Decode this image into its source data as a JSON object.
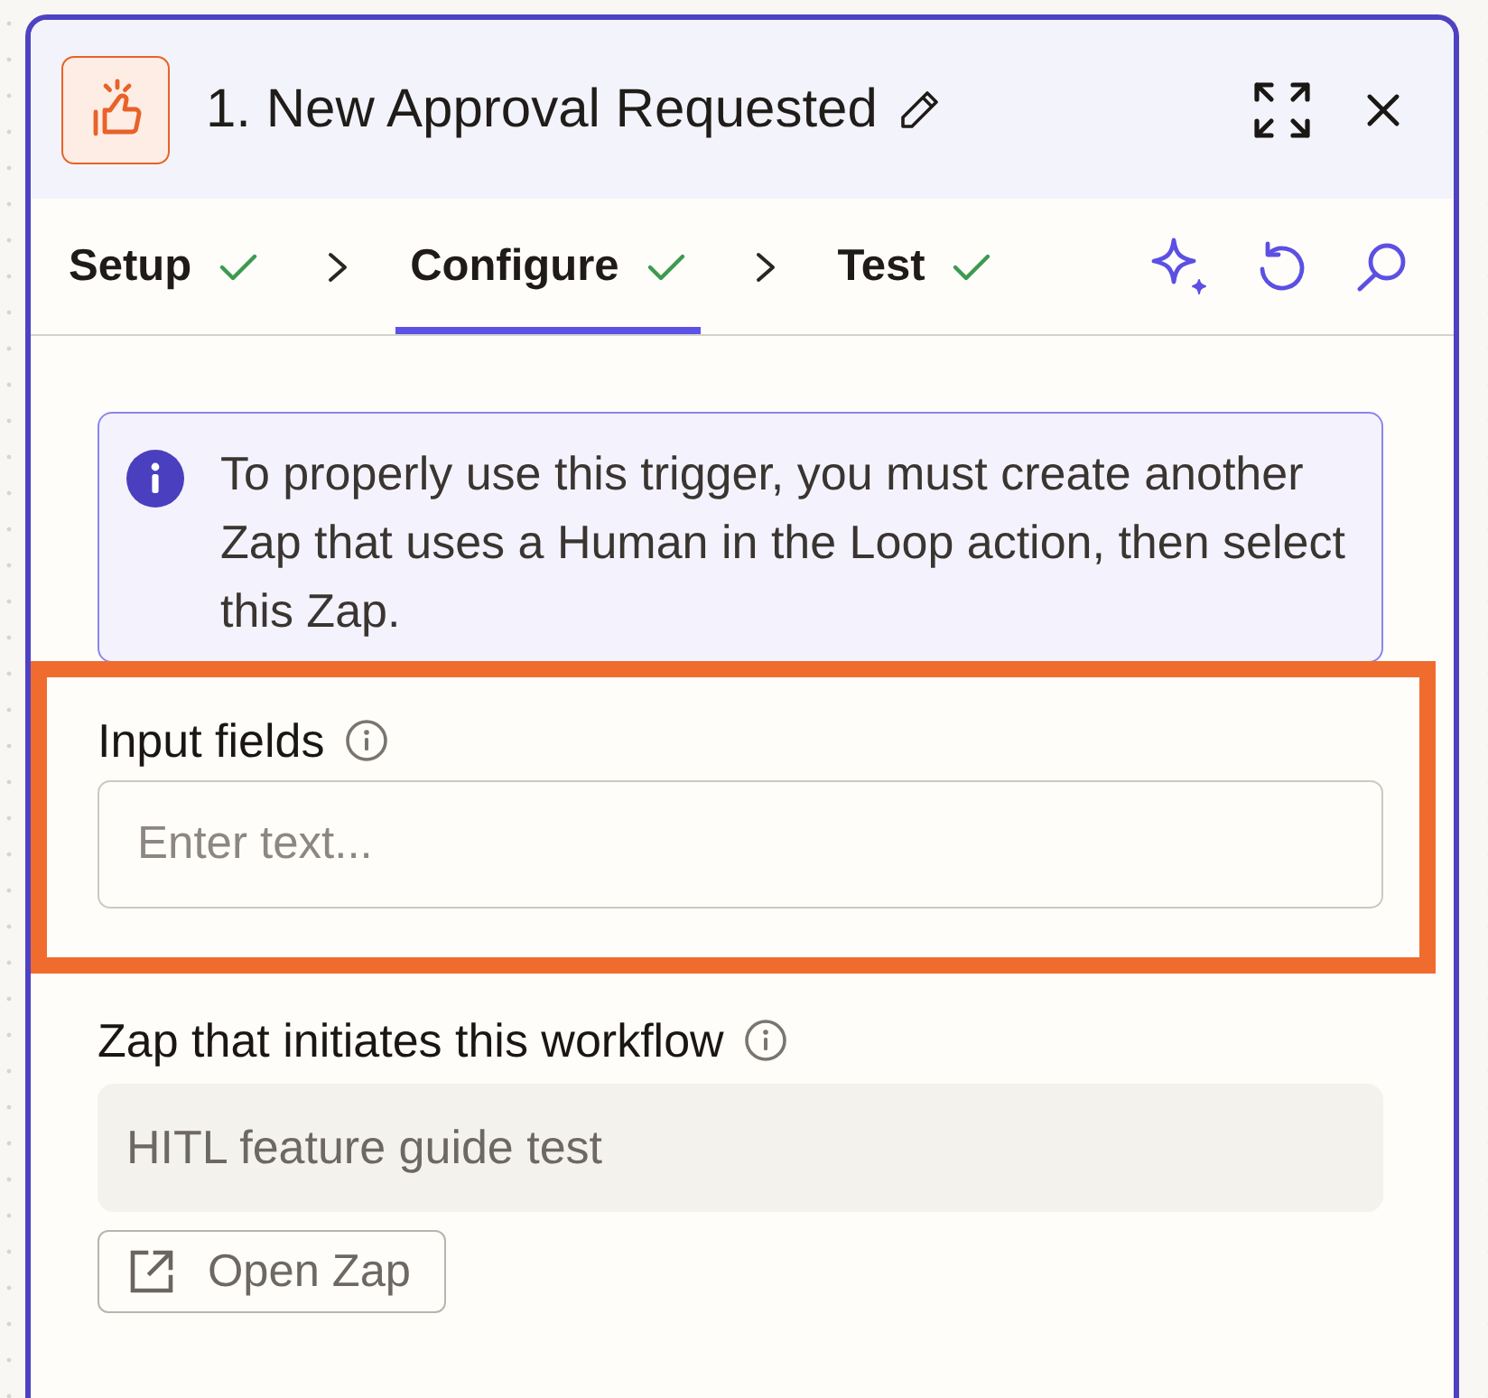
{
  "header": {
    "title": "1. New Approval Requested"
  },
  "tabs": [
    {
      "label": "Setup",
      "selected": false,
      "complete": true
    },
    {
      "label": "Configure",
      "selected": true,
      "complete": true
    },
    {
      "label": "Test",
      "selected": false,
      "complete": true
    }
  ],
  "notice": {
    "kind": "info",
    "text": "To properly use this trigger, you must create another Zap that uses a Human in the Loop action, then select this Zap."
  },
  "fields": [
    {
      "label": "Input fields",
      "placeholder": "Enter text...",
      "disabled": false,
      "highlighted": true
    },
    {
      "label": "Zap that initiates this workflow",
      "value": "HITL feature guide test",
      "disabled": true,
      "highlighted": false,
      "action": {
        "label": "Open Zap"
      }
    }
  ]
}
